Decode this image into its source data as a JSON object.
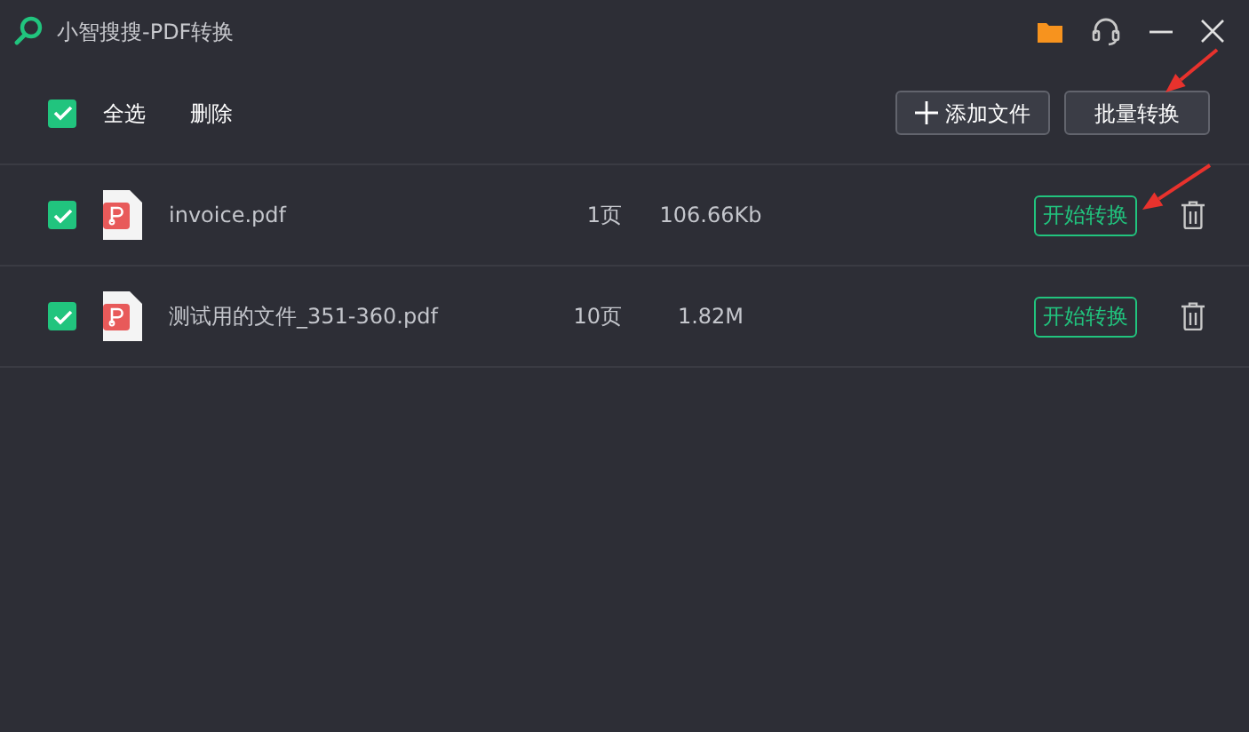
{
  "window": {
    "title": "小智搜搜-PDF转换"
  },
  "toolbar": {
    "select_all": {
      "label": "全选",
      "checked": true
    },
    "delete_label": "删除",
    "buttons": [
      {
        "kind": "add",
        "label": "添加文件"
      },
      {
        "kind": "batch",
        "label": "批量转换"
      }
    ]
  },
  "files": [
    {
      "name": "invoice.pdf",
      "pages": "1页",
      "size": "106.66Kb",
      "checked": true,
      "action": "开始转换"
    },
    {
      "name": "测试用的文件_351-360.pdf",
      "pages": "10页",
      "size": "1.82M",
      "checked": true,
      "action": "开始转换"
    }
  ],
  "annotations": [
    {
      "kind": "arrow"
    },
    {
      "kind": "arrow"
    }
  ]
}
